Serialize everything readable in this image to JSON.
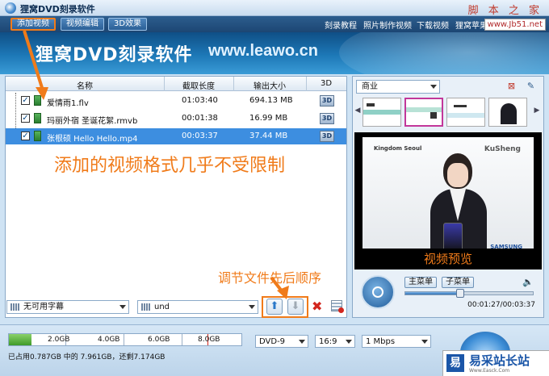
{
  "window": {
    "title": "狸窝DVD刻录软件",
    "watermark": "脚 本 之 家",
    "site": "www.Jb51.net"
  },
  "menubar": {
    "buttons": [
      {
        "label": "添加视频"
      },
      {
        "label": "视频编辑"
      },
      {
        "label": "3D效果"
      }
    ],
    "links": [
      {
        "label": "刻录教程"
      },
      {
        "label": "照片制作视频"
      },
      {
        "label": "下载视频"
      },
      {
        "label": "狸窝苹果"
      }
    ]
  },
  "banner": {
    "title": "狸窝DVD刻录软件",
    "url": "www.leawo.cn"
  },
  "table": {
    "headers": [
      "名称",
      "截取长度",
      "输出大小",
      "3D"
    ],
    "rows": [
      {
        "name": "爱情雨1.flv",
        "duration": "01:03:40",
        "size": "694.13 MB",
        "badge": "3D"
      },
      {
        "name": "玛丽外宿 圣诞花絮.rmvb",
        "duration": "00:01:38",
        "size": "16.99 MB",
        "badge": "3D"
      },
      {
        "name": "张根硕 Hello Hello.mp4",
        "duration": "00:03:37",
        "size": "37.44 MB",
        "badge": "3D"
      }
    ]
  },
  "annotations": {
    "formats": "添加的视频格式几乎不受限制",
    "order": "调节文件先后顺序",
    "preview": "视频预览"
  },
  "controls": {
    "subtitle": "无可用字幕",
    "audio": "und",
    "up_icon": "arrow-up-icon",
    "down_icon": "arrow-down-icon"
  },
  "menu_panel": {
    "theme": "商业",
    "main_menu": "主菜单",
    "sub_menu": "子菜单",
    "current_time": "00:01:27/00:03:37",
    "seek_progress": 0.43
  },
  "preview_logos": {
    "left": "Kingdom Seoul",
    "right": "KuSheng",
    "brand": "SAMSUNG"
  },
  "status": {
    "capacity_ticks": [
      "2.0GB",
      "4.0GB",
      "6.0GB",
      "8.0GB"
    ],
    "used_fraction": 0.098,
    "summary": "已占用0.787GB 中的 7.961GB，还剩7.174GB",
    "disc": "DVD-9",
    "aspect": "16:9",
    "bitrate": "1 Mbps"
  },
  "footer_brand": {
    "logo": "易",
    "name": "易采站长站",
    "sub": "Www.Easck.Com"
  },
  "colors": {
    "accent": "#f07b1a",
    "selection": "#3d8ee0",
    "banner": "#1d78b7"
  }
}
